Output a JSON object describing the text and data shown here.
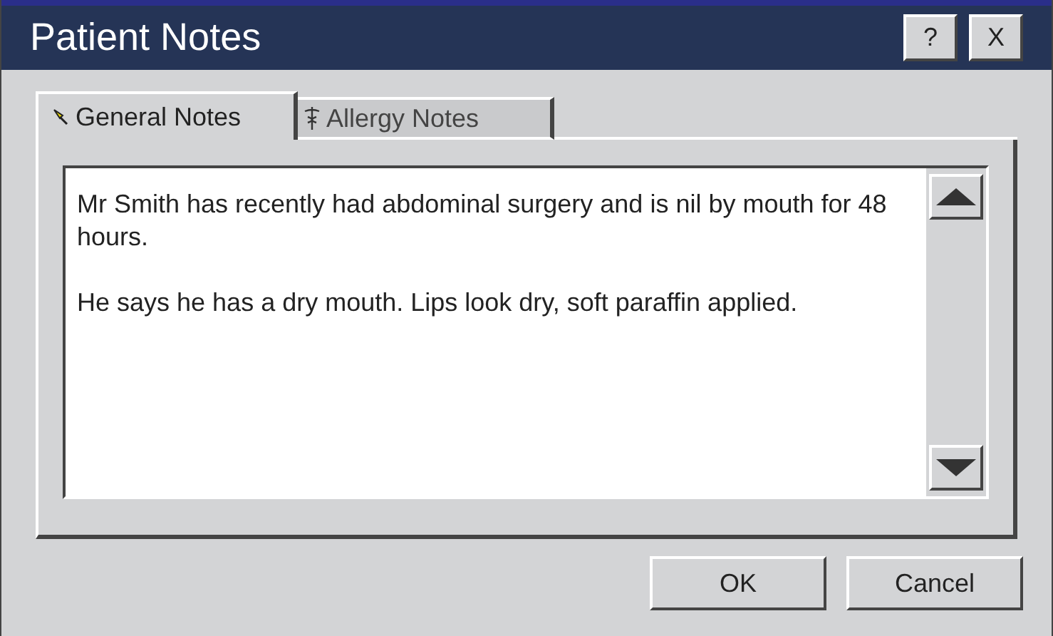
{
  "window": {
    "title": "Patient Notes",
    "buttons": [
      "?",
      "X"
    ]
  },
  "tabs": [
    {
      "label": "General Notes",
      "selected": true
    },
    {
      "label": "Allergy Notes",
      "selected": false
    }
  ],
  "notes": {
    "paragraphs": [
      "Mr Smith has recently had abdominal surgery and is nil by mouth for 48 hours.",
      "He says he has a dry mouth. Lips look dry, soft paraffin applied."
    ]
  },
  "buttons": [
    "OK",
    "Cancel"
  ]
}
